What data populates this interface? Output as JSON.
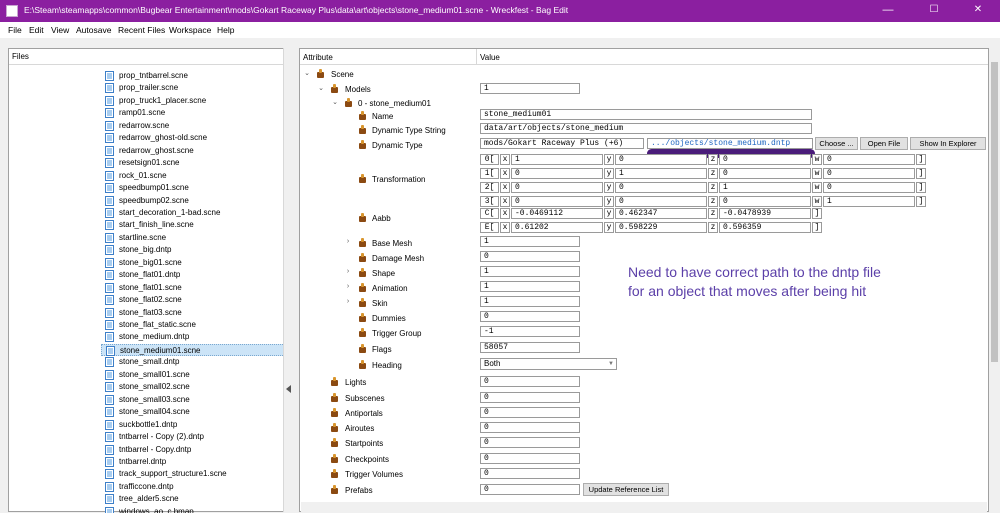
{
  "window": {
    "title": "E:\\Steam\\steamapps\\common\\Bugbear Entertainment\\mods\\Gokart Raceway Plus\\data\\art\\objects\\stone_medium01.scne - Wreckfest - Bag Edit",
    "minimize_glyph": "—",
    "maximize_glyph": "☐",
    "close_glyph": "✕"
  },
  "menu": [
    "File",
    "Edit",
    "View",
    "Autosave",
    "Recent Files",
    "Workspace",
    "Help"
  ],
  "files": {
    "header": "Files",
    "items": [
      "prop_tntbarrel.scne",
      "prop_trailer.scne",
      "prop_truck1_placer.scne",
      "ramp01.scne",
      "redarrow.scne",
      "redarrow_ghost-old.scne",
      "redarrow_ghost.scne",
      "resetsign01.scne",
      "rock_01.scne",
      "speedbump01.scne",
      "speedbump02.scne",
      "start_decoration_1-bad.scne",
      "start_finish_line.scne",
      "startline.scne",
      "stone_big.dntp",
      "stone_big01.scne",
      "stone_flat01.dntp",
      "stone_flat01.scne",
      "stone_flat02.scne",
      "stone_flat03.scne",
      "stone_flat_static.scne",
      "stone_medium.dntp",
      "stone_medium01.scne",
      "stone_small.dntp",
      "stone_small01.scne",
      "stone_small02.scne",
      "stone_small03.scne",
      "stone_small04.scne",
      "suckbottle1.dntp",
      "tntbarrel - Copy (2).dntp",
      "tntbarrel - Copy.dntp",
      "tntbarrel.dntp",
      "track_support_structure1.scne",
      "trafficcone.dntp",
      "tree_alder5.scne",
      "windows_ao_c.bmap"
    ],
    "selected_index": 22
  },
  "attributes": {
    "col_attribute": "Attribute",
    "col_value": "Value",
    "scene": "Scene",
    "models": {
      "label": "Models",
      "value": "1"
    },
    "model0": {
      "label": "0 - stone_medium01"
    },
    "name": {
      "label": "Name",
      "value": "stone_medium01"
    },
    "dyn_type_string": {
      "label": "Dynamic Type String",
      "value": "data/art/objects/stone_medium"
    },
    "dyn_type": {
      "label": "Dynamic Type",
      "value_a": "mods/Gokart Raceway Plus (+6)",
      "value_b": ".../objects/stone_medium.dntp",
      "choose": "Choose ...",
      "open": "Open File",
      "explorer": "Show In Explorer"
    },
    "transformation": {
      "label": "Transformation",
      "rows": [
        {
          "idx": "0[",
          "x": "1",
          "y": "0",
          "z": "0",
          "w": "0"
        },
        {
          "idx": "1[",
          "x": "0",
          "y": "1",
          "z": "0",
          "w": "0"
        },
        {
          "idx": "2[",
          "x": "0",
          "y": "0",
          "z": "1",
          "w": "0"
        },
        {
          "idx": "3[",
          "x": "0",
          "y": "0",
          "z": "0",
          "w": "1"
        }
      ]
    },
    "aabb": {
      "label": "Aabb",
      "rows": [
        {
          "idx": "C[",
          "x": "-0.0469112",
          "y": "0.462347",
          "z": "-0.0478939"
        },
        {
          "idx": "E[",
          "x": "0.61202",
          "y": "0.598229",
          "z": "0.596359"
        }
      ]
    },
    "axis": {
      "x": "x",
      "y": "y",
      "z": "z",
      "w": "w",
      "close": "]"
    },
    "base_mesh": {
      "label": "Base Mesh",
      "value": "1"
    },
    "damage_mesh": {
      "label": "Damage Mesh",
      "value": "0"
    },
    "shape": {
      "label": "Shape",
      "value": "1"
    },
    "animation": {
      "label": "Animation",
      "value": "1"
    },
    "skin": {
      "label": "Skin",
      "value": "1"
    },
    "dummies": {
      "label": "Dummies",
      "value": "0"
    },
    "trigger_group": {
      "label": "Trigger Group",
      "value": "-1"
    },
    "flags": {
      "label": "Flags",
      "value": "58057"
    },
    "heading": {
      "label": "Heading",
      "value": "Both"
    },
    "lights": {
      "label": "Lights",
      "value": "0"
    },
    "subscenes": {
      "label": "Subscenes",
      "value": "0"
    },
    "antiportals": {
      "label": "Antiportals",
      "value": "0"
    },
    "airoutes": {
      "label": "Airoutes",
      "value": "0"
    },
    "startpoints": {
      "label": "Startpoints",
      "value": "0"
    },
    "checkpoints": {
      "label": "Checkpoints",
      "value": "0"
    },
    "trigger_volumes": {
      "label": "Trigger Volumes",
      "value": "0"
    },
    "prefabs": {
      "label": "Prefabs",
      "value": "0",
      "button": "Update Reference List"
    }
  },
  "annotation": {
    "line1": "Need to have correct path to the dntp file",
    "line2": "for an object that moves after being hit"
  },
  "colors": {
    "titlebar": "#8b1fa0",
    "selection": "#cce4f7",
    "annotation": "#5b3fa8",
    "scribble": "#4a1c7a"
  }
}
